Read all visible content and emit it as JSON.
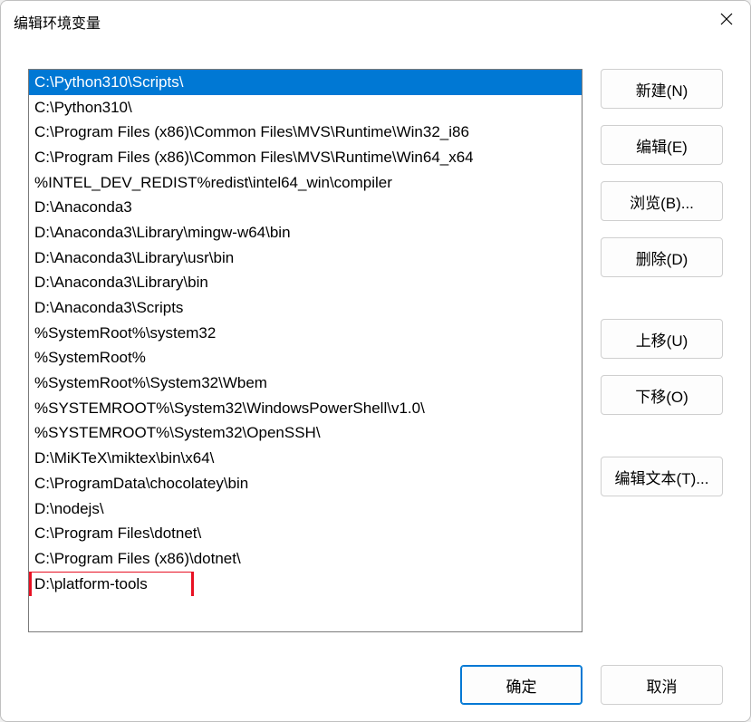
{
  "dialog": {
    "title": "编辑环境变量"
  },
  "list": {
    "items": [
      "C:\\Python310\\Scripts\\",
      "C:\\Python310\\",
      "C:\\Program Files (x86)\\Common Files\\MVS\\Runtime\\Win32_i86",
      "C:\\Program Files (x86)\\Common Files\\MVS\\Runtime\\Win64_x64",
      "%INTEL_DEV_REDIST%redist\\intel64_win\\compiler",
      "D:\\Anaconda3",
      "D:\\Anaconda3\\Library\\mingw-w64\\bin",
      "D:\\Anaconda3\\Library\\usr\\bin",
      "D:\\Anaconda3\\Library\\bin",
      "D:\\Anaconda3\\Scripts",
      "%SystemRoot%\\system32",
      "%SystemRoot%",
      "%SystemRoot%\\System32\\Wbem",
      "%SYSTEMROOT%\\System32\\WindowsPowerShell\\v1.0\\",
      "%SYSTEMROOT%\\System32\\OpenSSH\\",
      "D:\\MiKTeX\\miktex\\bin\\x64\\",
      "C:\\ProgramData\\chocolatey\\bin",
      "D:\\nodejs\\",
      "C:\\Program Files\\dotnet\\",
      "C:\\Program Files (x86)\\dotnet\\",
      "D:\\platform-tools"
    ],
    "selected_index": 0,
    "highlighted_red_index": 20
  },
  "buttons": {
    "new": "新建(N)",
    "edit": "编辑(E)",
    "browse": "浏览(B)...",
    "delete": "删除(D)",
    "move_up": "上移(U)",
    "move_down": "下移(O)",
    "edit_text": "编辑文本(T)...",
    "ok": "确定",
    "cancel": "取消"
  }
}
